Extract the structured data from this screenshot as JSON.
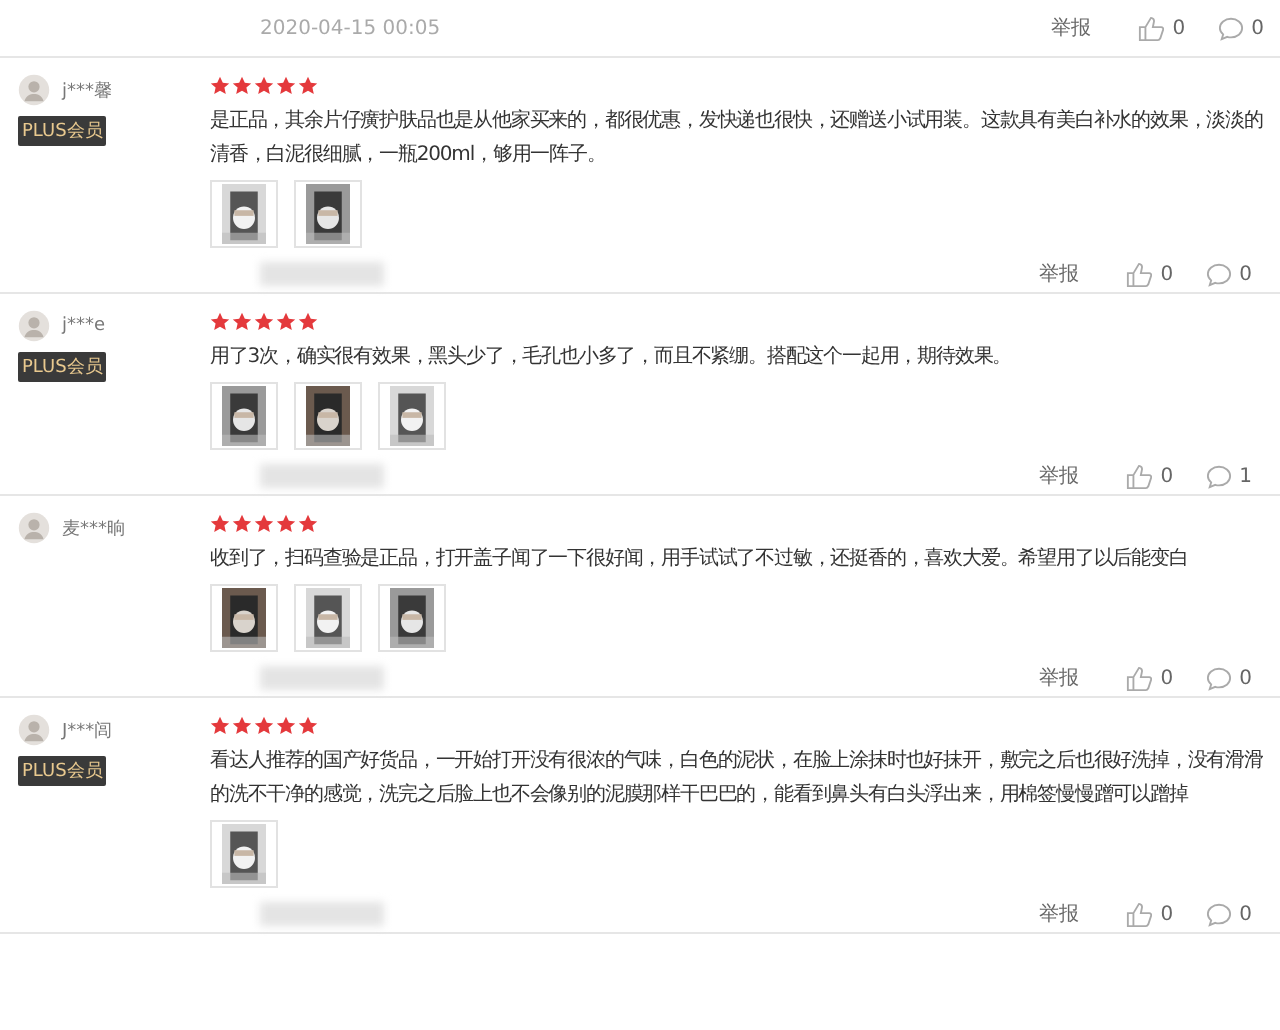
{
  "top_footer": {
    "date": "2020-04-15 00:05",
    "report": "举报",
    "likes": "0",
    "comments": "0"
  },
  "reviews": [
    {
      "user": "j***馨",
      "badge": "PLUS会员",
      "stars": 5,
      "text": "是正品，其余片仔癀护肤品也是从他家买来的，都很优惠，发快递也很快，还赠送小试用装。这款具有美白补水的效果，淡淡的清香，白泥很细腻，一瓶200ml，够用一阵子。",
      "images": [
        {
          "kind": "picture"
        },
        {
          "kind": "picture"
        }
      ],
      "footer": {
        "date_blurred": true,
        "report": "举报",
        "likes": "0",
        "comments": "0"
      }
    },
    {
      "user": "j***e",
      "badge": "PLUS会员",
      "stars": 5,
      "text": "用了3次，确实很有效果，黑头少了，毛孔也小多了，而且不紧绷。搭配这个一起用，期待效果。",
      "images": [
        {
          "kind": "picture"
        },
        {
          "kind": "picture"
        },
        {
          "kind": "picture"
        }
      ],
      "footer": {
        "date_blurred": true,
        "report": "举报",
        "likes": "0",
        "comments": "1"
      }
    },
    {
      "user": "麦***晌",
      "stars": 5,
      "text": "收到了，扫码查验是正品，打开盖子闻了一下很好闻，用手试试了不过敏，还挺香的，喜欢大爱。希望用了以后能变白",
      "images": [
        {
          "kind": "picture"
        },
        {
          "kind": "picture"
        },
        {
          "kind": "picture"
        }
      ],
      "footer": {
        "date_blurred": true,
        "report": "举报",
        "likes": "0",
        "comments": "0"
      }
    },
    {
      "user": "J***闾",
      "badge": "PLUS会员",
      "stars": 5,
      "text": "看达人推荐的国产好货品，一开始打开没有很浓的气味，白色的泥状，在脸上涂抹时也好抹开，敷完之后也很好洗掉，没有滑滑的洗不干净的感觉，洗完之后脸上也不会像别的泥膜那样干巴巴的，能看到鼻头有白头浮出来，用棉签慢慢蹭可以蹭掉",
      "images": [
        {
          "kind": "picture"
        }
      ],
      "footer": {
        "date_blurred": true,
        "report": "举报",
        "likes": "0",
        "comments": "0"
      }
    }
  ]
}
